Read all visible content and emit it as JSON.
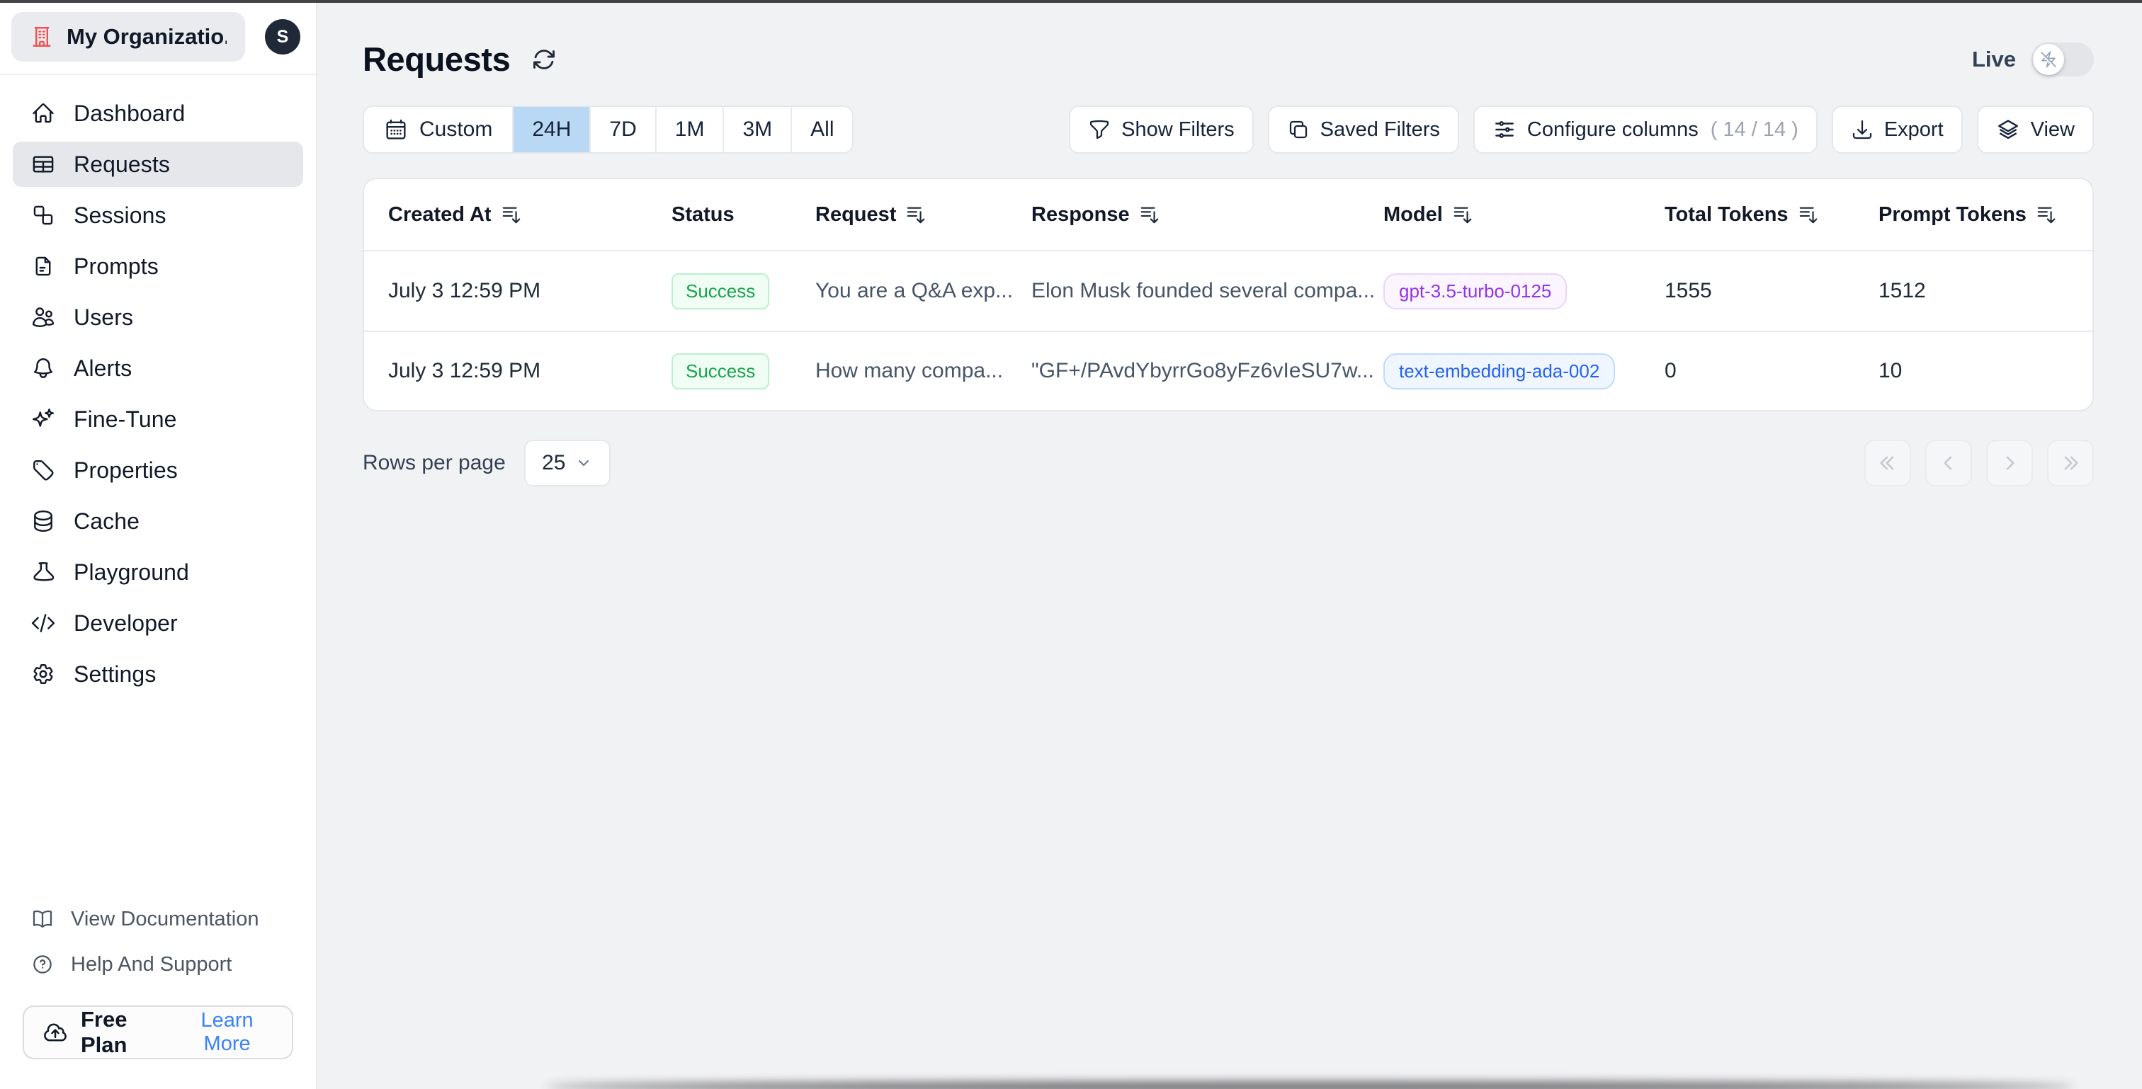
{
  "sidebar": {
    "org": {
      "name": "My Organizatio...",
      "avatar_initial": "S"
    },
    "items": [
      {
        "label": "Dashboard",
        "icon": "home-icon",
        "active": false
      },
      {
        "label": "Requests",
        "icon": "table-icon",
        "active": true
      },
      {
        "label": "Sessions",
        "icon": "sessions-icon",
        "active": false
      },
      {
        "label": "Prompts",
        "icon": "document-icon",
        "active": false
      },
      {
        "label": "Users",
        "icon": "users-icon",
        "active": false
      },
      {
        "label": "Alerts",
        "icon": "bell-icon",
        "active": false
      },
      {
        "label": "Fine-Tune",
        "icon": "sparkles-icon",
        "active": false
      },
      {
        "label": "Properties",
        "icon": "tag-icon",
        "active": false
      },
      {
        "label": "Cache",
        "icon": "database-icon",
        "active": false
      },
      {
        "label": "Playground",
        "icon": "beaker-icon",
        "active": false
      },
      {
        "label": "Developer",
        "icon": "code-icon",
        "active": false
      },
      {
        "label": "Settings",
        "icon": "gear-icon",
        "active": false
      }
    ],
    "footer_links": [
      {
        "label": "View Documentation",
        "icon": "book-open-icon"
      },
      {
        "label": "Help And Support",
        "icon": "question-circle-icon"
      }
    ],
    "plan": {
      "label": "Free Plan",
      "action": "Learn More",
      "icon": "cloud-upload-icon"
    }
  },
  "header": {
    "title": "Requests",
    "live_label": "Live",
    "live_on": false
  },
  "toolbar": {
    "time_ranges": [
      "Custom",
      "24H",
      "7D",
      "1M",
      "3M",
      "All"
    ],
    "selected_range": "24H",
    "buttons": {
      "show_filters": "Show Filters",
      "saved_filters": "Saved Filters",
      "configure_columns": "Configure columns",
      "configure_columns_count": "( 14 / 14 )",
      "export": "Export",
      "view": "View"
    }
  },
  "table": {
    "columns": [
      {
        "label": "Created At",
        "sortable": true
      },
      {
        "label": "Status",
        "sortable": false
      },
      {
        "label": "Request",
        "sortable": true
      },
      {
        "label": "Response",
        "sortable": true
      },
      {
        "label": "Model",
        "sortable": true
      },
      {
        "label": "Total Tokens",
        "sortable": true
      },
      {
        "label": "Prompt Tokens",
        "sortable": true
      }
    ],
    "rows": [
      {
        "created_at": "July 3 12:59 PM",
        "status": "Success",
        "request": "You are a Q&A exp...",
        "response": "Elon Musk founded several compa...",
        "model": "gpt-3.5-turbo-0125",
        "model_color": "purple",
        "total_tokens": "1555",
        "prompt_tokens": "1512"
      },
      {
        "created_at": "July 3 12:59 PM",
        "status": "Success",
        "request": "How many compa...",
        "response": "\"GF+/PAvdYbyrrGo8yFz6vIeSU7w...",
        "model": "text-embedding-ada-002",
        "model_color": "blue",
        "total_tokens": "0",
        "prompt_tokens": "10"
      }
    ]
  },
  "pagination": {
    "rows_per_page_label": "Rows per page",
    "rows_per_page_value": "25"
  },
  "colors": {
    "page_bg": "#f1f2f4",
    "sidebar_bg": "#ffffff",
    "selected_nav_bg": "#e5e7eb",
    "selected_range_bg": "#b9d8f3",
    "org_icon_red": "#ef5350",
    "success_text": "#16a34a",
    "success_bg": "#f0fdf4",
    "success_border": "#bcf0cd",
    "model_purple_text": "#9333ea",
    "model_blue_text": "#2563eb",
    "learn_more_blue": "#3b82f6",
    "avatar_bg": "#1f2937"
  }
}
